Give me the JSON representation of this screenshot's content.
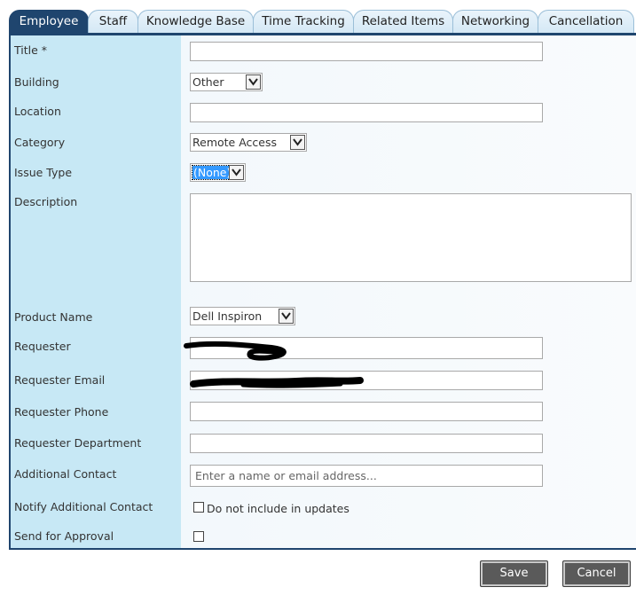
{
  "tabs": [
    {
      "label": "Employee",
      "active": true
    },
    {
      "label": "Staff",
      "active": false
    },
    {
      "label": "Knowledge Base",
      "active": false
    },
    {
      "label": "Time Tracking",
      "active": false
    },
    {
      "label": "Related Items",
      "active": false
    },
    {
      "label": "Networking",
      "active": false
    },
    {
      "label": "Cancellation",
      "active": false
    }
  ],
  "form": {
    "title": {
      "label": "Title *",
      "value": ""
    },
    "building": {
      "label": "Building",
      "selected": "Other"
    },
    "location": {
      "label": "Location",
      "value": ""
    },
    "category": {
      "label": "Category",
      "selected": "Remote Access"
    },
    "issue_type": {
      "label": "Issue Type",
      "selected": "(None)"
    },
    "description": {
      "label": "Description",
      "value": ""
    },
    "product_name": {
      "label": "Product Name",
      "selected": "Dell Inspiron"
    },
    "requester": {
      "label": "Requester",
      "value": ""
    },
    "requester_email": {
      "label": "Requester Email",
      "value": ""
    },
    "requester_phone": {
      "label": "Requester Phone",
      "value": ""
    },
    "requester_department": {
      "label": "Requester Department",
      "value": ""
    },
    "additional_contact": {
      "label": "Additional Contact",
      "placeholder": "Enter a name or email address..."
    },
    "notify_additional_contact": {
      "label": "Notify Additional Contact",
      "checkbox_label": "Do not include in updates",
      "checked": false
    },
    "send_for_approval": {
      "label": "Send for Approval",
      "checked": false
    }
  },
  "buttons": {
    "save": "Save",
    "cancel": "Cancel"
  },
  "colors": {
    "tab_active": "#1f456e",
    "label_column": "#c7e8f5",
    "button": "#5a5a5a"
  }
}
